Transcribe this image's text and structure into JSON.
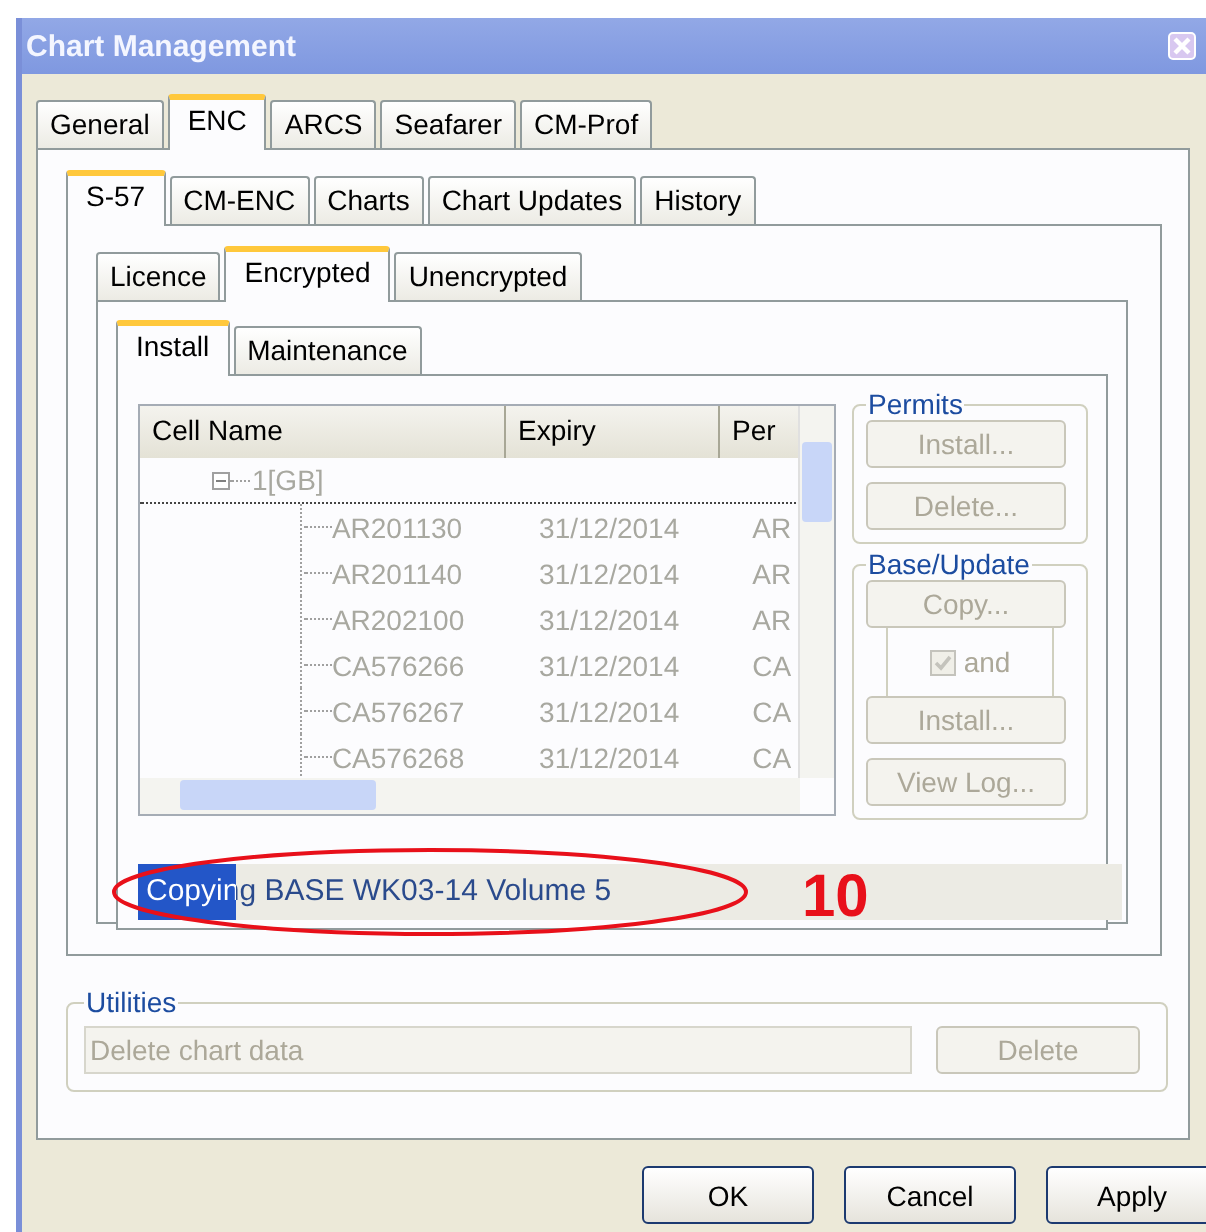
{
  "window": {
    "title": "Chart Management"
  },
  "tabs": [
    {
      "label": "General",
      "selected": false
    },
    {
      "label": "ENC",
      "selected": true
    },
    {
      "label": "ARCS",
      "selected": false
    },
    {
      "label": "Seafarer",
      "selected": false
    },
    {
      "label": "CM-Prof",
      "selected": false
    }
  ],
  "enc_tabs": [
    {
      "label": "S-57",
      "selected": true
    },
    {
      "label": "CM-ENC",
      "selected": false
    },
    {
      "label": "Charts",
      "selected": false
    },
    {
      "label": "Chart Updates",
      "selected": false
    },
    {
      "label": "History",
      "selected": false
    }
  ],
  "s57_tabs": [
    {
      "label": "Licence",
      "selected": false
    },
    {
      "label": "Encrypted",
      "selected": true
    },
    {
      "label": "Unencrypted",
      "selected": false
    }
  ],
  "encrypted_tabs": [
    {
      "label": "Install",
      "selected": true
    },
    {
      "label": "Maintenance",
      "selected": false
    }
  ],
  "table": {
    "disabled": true,
    "columns": [
      "Cell Name",
      "Expiry",
      "Per"
    ],
    "tree": [
      {
        "label": "1[GB]",
        "expanded": true,
        "children": [
          {
            "cells": [
              "AR201130",
              "31/12/2014",
              "AR"
            ]
          },
          {
            "cells": [
              "AR201140",
              "31/12/2014",
              "AR"
            ]
          },
          {
            "cells": [
              "AR202100",
              "31/12/2014",
              "AR"
            ]
          },
          {
            "cells": [
              "CA576266",
              "31/12/2014",
              "CA"
            ]
          },
          {
            "cells": [
              "CA576267",
              "31/12/2014",
              "CA"
            ]
          },
          {
            "cells": [
              "CA576268",
              "31/12/2014",
              "CA"
            ]
          }
        ]
      }
    ]
  },
  "permits": {
    "title": "Permits",
    "items": [
      {
        "kind": "button",
        "label": "Install...",
        "disabled": true
      },
      {
        "kind": "button",
        "label": "Delete...",
        "disabled": true
      }
    ]
  },
  "base_update": {
    "title": "Base/Update",
    "items": [
      {
        "kind": "button",
        "label": "Copy...",
        "disabled": true
      },
      {
        "kind": "checkbox",
        "label": "and",
        "checked": true,
        "disabled": true
      },
      {
        "kind": "button",
        "label": "Install...",
        "disabled": true
      },
      {
        "kind": "button",
        "label": "View Log...",
        "disabled": true
      }
    ]
  },
  "status": {
    "text": "Copying BASE WK03-14 Volume 5",
    "level": 0.1
  },
  "annotation": {
    "number": "10"
  },
  "utilities": {
    "title": "Utilities",
    "field": {
      "value": "Delete chart data",
      "disabled": true
    },
    "button": {
      "label": "Delete",
      "disabled": true
    }
  },
  "buttons": [
    {
      "label": "OK"
    },
    {
      "label": "Cancel"
    },
    {
      "label": "Apply"
    }
  ]
}
